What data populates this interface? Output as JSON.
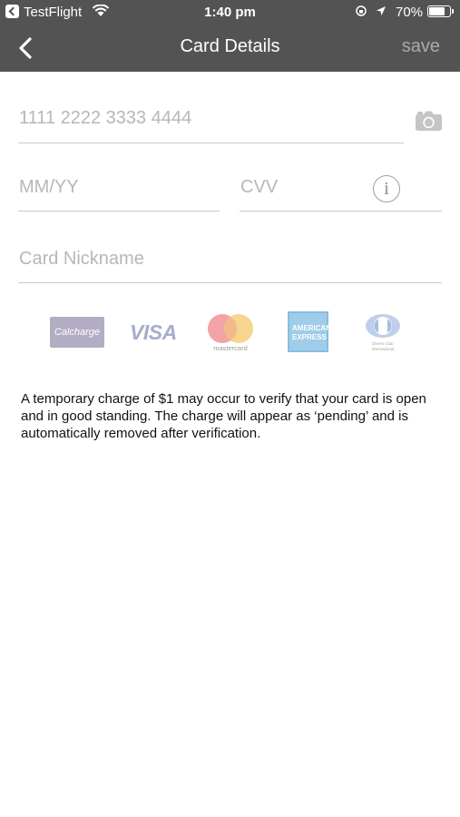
{
  "status_bar": {
    "back_app": "TestFlight",
    "time": "1:40 pm",
    "battery": "70%",
    "battery_level": 0.7
  },
  "nav": {
    "title": "Card Details",
    "save_label": "save"
  },
  "form": {
    "card_number_placeholder": "1111 2222 3333 4444",
    "expiry_placeholder": "MM/YY",
    "cvv_placeholder": "CVV",
    "nickname_placeholder": "Card Nickname",
    "info_glyph": "i"
  },
  "brands": {
    "calcharge": "Calcharge",
    "visa": "VISA",
    "mastercard": "mastercard",
    "amex_line1": "AMERICAN",
    "amex_line2": "EXPRESS",
    "diners_line1": "Diners Club",
    "diners_line2": "International"
  },
  "note": "A temporary charge of $1 may occur to verify that your card is open and in good standing. The charge will appear as ‘pending’ and is automatically removed after verification.",
  "icons": [
    "back-chevron-icon",
    "camera-icon",
    "info-icon",
    "wifi-icon",
    "location-arrow-icon",
    "orientation-lock-icon",
    "battery-icon"
  ],
  "colors": {
    "nav_background": "#535353",
    "placeholder": "#b7b7b7",
    "divider": "#c8c8c8",
    "save_disabled": "#a9a9a9"
  }
}
